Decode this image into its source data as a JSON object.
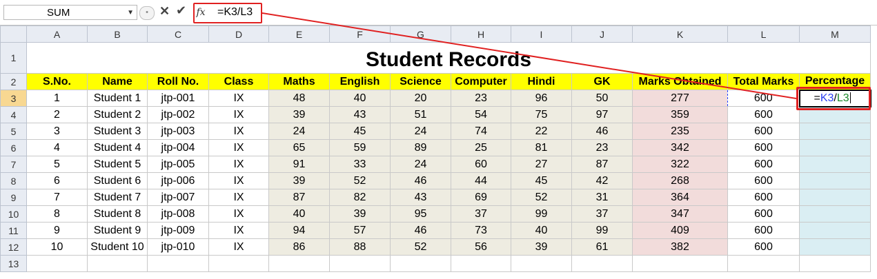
{
  "formula_bar": {
    "name_box": "SUM",
    "formula": "=K3/L3",
    "fx_label": "fx"
  },
  "columns": [
    "A",
    "B",
    "C",
    "D",
    "E",
    "F",
    "G",
    "H",
    "I",
    "J",
    "K",
    "L",
    "M"
  ],
  "rows": [
    "1",
    "2",
    "3",
    "4",
    "5",
    "6",
    "7",
    "8",
    "9",
    "10",
    "11",
    "12",
    "13"
  ],
  "title": "Student Records",
  "headers": [
    "S.No.",
    "Name",
    "Roll No.",
    "Class",
    "Maths",
    "English",
    "Science",
    "Computer",
    "Hindi",
    "GK",
    "Marks Obtained",
    "Total Marks",
    "Percentage"
  ],
  "students": [
    {
      "sno": "1",
      "name": "Student 1",
      "roll": "jtp-001",
      "cls": "IX",
      "maths": "48",
      "english": "40",
      "science": "20",
      "computer": "23",
      "hindi": "96",
      "gk": "50",
      "obtained": "277",
      "total": "600"
    },
    {
      "sno": "2",
      "name": "Student 2",
      "roll": "jtp-002",
      "cls": "IX",
      "maths": "39",
      "english": "43",
      "science": "51",
      "computer": "54",
      "hindi": "75",
      "gk": "97",
      "obtained": "359",
      "total": "600"
    },
    {
      "sno": "3",
      "name": "Student 3",
      "roll": "jtp-003",
      "cls": "IX",
      "maths": "24",
      "english": "45",
      "science": "24",
      "computer": "74",
      "hindi": "22",
      "gk": "46",
      "obtained": "235",
      "total": "600"
    },
    {
      "sno": "4",
      "name": "Student 4",
      "roll": "jtp-004",
      "cls": "IX",
      "maths": "65",
      "english": "59",
      "science": "89",
      "computer": "25",
      "hindi": "81",
      "gk": "23",
      "obtained": "342",
      "total": "600"
    },
    {
      "sno": "5",
      "name": "Student 5",
      "roll": "jtp-005",
      "cls": "IX",
      "maths": "91",
      "english": "33",
      "science": "24",
      "computer": "60",
      "hindi": "27",
      "gk": "87",
      "obtained": "322",
      "total": "600"
    },
    {
      "sno": "6",
      "name": "Student 6",
      "roll": "jtp-006",
      "cls": "IX",
      "maths": "39",
      "english": "52",
      "science": "46",
      "computer": "44",
      "hindi": "45",
      "gk": "42",
      "obtained": "268",
      "total": "600"
    },
    {
      "sno": "7",
      "name": "Student 7",
      "roll": "jtp-007",
      "cls": "IX",
      "maths": "87",
      "english": "82",
      "science": "43",
      "computer": "69",
      "hindi": "52",
      "gk": "31",
      "obtained": "364",
      "total": "600"
    },
    {
      "sno": "8",
      "name": "Student 8",
      "roll": "jtp-008",
      "cls": "IX",
      "maths": "40",
      "english": "39",
      "science": "95",
      "computer": "37",
      "hindi": "99",
      "gk": "37",
      "obtained": "347",
      "total": "600"
    },
    {
      "sno": "9",
      "name": "Student 9",
      "roll": "jtp-009",
      "cls": "IX",
      "maths": "94",
      "english": "57",
      "science": "46",
      "computer": "73",
      "hindi": "40",
      "gk": "99",
      "obtained": "409",
      "total": "600"
    },
    {
      "sno": "10",
      "name": "Student 10",
      "roll": "jtp-010",
      "cls": "IX",
      "maths": "86",
      "english": "88",
      "science": "52",
      "computer": "56",
      "hindi": "39",
      "gk": "61",
      "obtained": "382",
      "total": "600"
    }
  ],
  "active_cell_formula": {
    "eq": "=",
    "ref1": "K3",
    "op": "/",
    "ref2": "L3"
  },
  "colors": {
    "header_yellow": "#ffff00",
    "subject_fill": "#eeece1",
    "marks_fill": "#f2dcdb",
    "percent_fill": "#daeef3",
    "highlight_red": "#e02020"
  }
}
